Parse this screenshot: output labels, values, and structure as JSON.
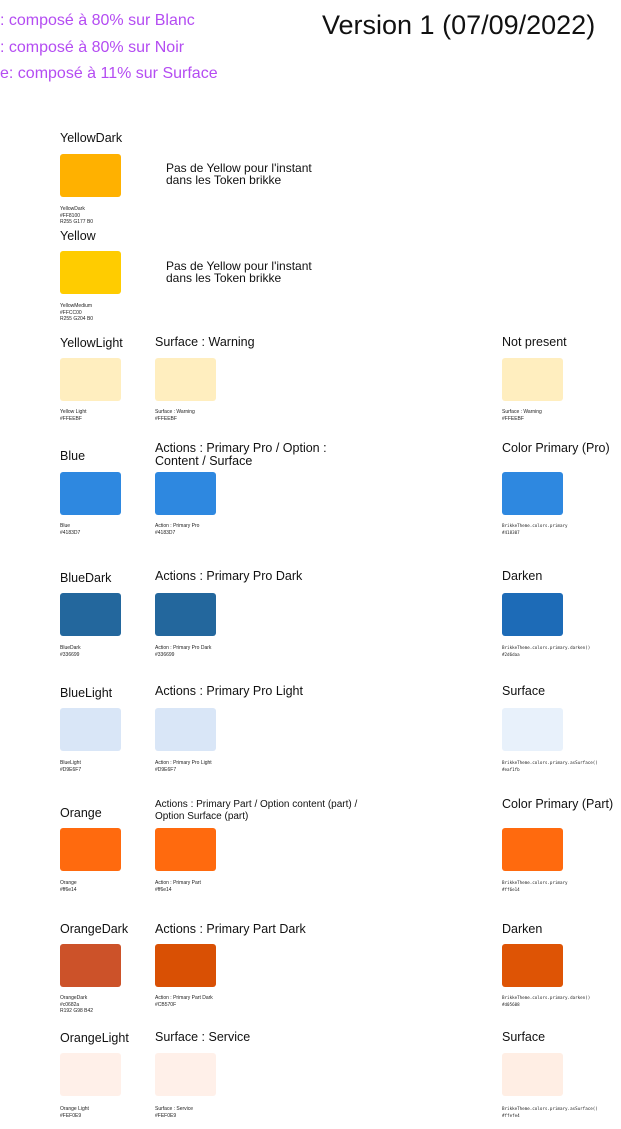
{
  "legend": [
    ": composé à 80% sur Blanc",
    ": composé à 80% sur Noir",
    "e: composé à 11% sur Surface"
  ],
  "version": "Version 1 (07/09/2022)",
  "yellow_dark": {
    "title": "YellowDark",
    "color": "#FFB100",
    "caption": [
      "YellowDark",
      "#FF8100",
      "R255 G177 B0"
    ],
    "note": [
      "Pas de Yellow pour l'instant",
      "dans les Token brikke"
    ]
  },
  "yellow": {
    "title": "Yellow",
    "color": "#FFCC00",
    "caption": [
      "YellowMedium",
      "#FFCC00",
      "R255 G204 B0"
    ],
    "note": [
      "Pas de Yellow pour l'instant",
      "dans les Token brikke"
    ]
  },
  "yellow_light": {
    "title": "YellowLight",
    "c1": {
      "color": "#FFEEBF",
      "caption": [
        "Yellow Light",
        "#FFEEBF"
      ]
    },
    "c2": {
      "title": "Surface : Warning",
      "color": "#FFEEBF",
      "caption": [
        "Surface : Warning",
        "#FFEEBF"
      ]
    },
    "c3": {
      "title": "Not present",
      "color": "#FFEEBF",
      "caption": [
        "Surface : Warning",
        "#FFEEBF"
      ]
    }
  },
  "blue": {
    "title": "Blue",
    "c1": {
      "color": "#2E88E0",
      "caption": [
        "Blue",
        "#4183D7"
      ]
    },
    "c2": {
      "title": [
        "Actions : Primary Pro / Option :",
        "Content / Surface"
      ],
      "color": "#2E88E0",
      "caption": [
        "Action : Primary Pro",
        "#4183D7"
      ]
    },
    "c3": {
      "title": "Color Primary (Pro)",
      "color": "#2E88E0",
      "caption": [
        "BrikkeTheme.colors.primary",
        "#418307"
      ]
    }
  },
  "blue_dark": {
    "title": "BlueDark",
    "c1": {
      "color": "#23679D",
      "caption": [
        "BlueDark",
        "#336699"
      ]
    },
    "c2": {
      "title": "Actions : Primary Pro Dark",
      "color": "#23679D",
      "caption": [
        "Action : Primary Pro Dark",
        "#336699"
      ]
    },
    "c3": {
      "title": "Darken",
      "color": "#1D6BB7",
      "caption": [
        "BrikkeTheme.colors.primary.darken()",
        "#2d6daa"
      ]
    }
  },
  "blue_light": {
    "title": "BlueLight",
    "c1": {
      "color": "#D9E6F7",
      "caption": [
        "BlueLight",
        "#D9E6F7"
      ]
    },
    "c2": {
      "title": "Actions : Primary Pro Light",
      "color": "#D9E6F7",
      "caption": [
        "Action : Primary Pro Light",
        "#D9E6F7"
      ]
    },
    "c3": {
      "title": "Surface",
      "color": "#E8F1FB",
      "caption": [
        "BrikkeTheme.colors.primary.asSurface()",
        "#eaf1fb"
      ]
    }
  },
  "orange": {
    "title": "Orange",
    "c1": {
      "color": "#FF6A0E",
      "caption": [
        "Orange",
        "#ff6e14"
      ]
    },
    "c2": {
      "title": [
        "Actions : Primary Part / Option content (part) /",
        "Option Surface (part)"
      ],
      "color": "#FF6A0E",
      "caption": [
        "Action : Primary Part",
        "#ff6e14"
      ]
    },
    "c3": {
      "title": "Color Primary (Part)",
      "color": "#FF6A0E",
      "caption": [
        "BrikkeTheme.colors.primary",
        "#ff6e14"
      ]
    }
  },
  "orange_dark": {
    "title": "OrangeDark",
    "c1": {
      "color": "#CC5229",
      "caption": [
        "OrangeDark",
        "#c0682a",
        "R192 G98 B42"
      ]
    },
    "c2": {
      "title": "Actions : Primary Part Dark",
      "color": "#D95004",
      "caption": [
        "Action : Primary Part Dark",
        "#CB570F"
      ]
    },
    "c3": {
      "title": "Darken",
      "color": "#DE5405",
      "caption": [
        "BrikkeTheme.colors.primary.darken()",
        "#d05608"
      ]
    }
  },
  "orange_light": {
    "title": "OrangeLight",
    "c1": {
      "color": "#FFF0E9",
      "caption": [
        "Orange Light",
        "#FEF0E9"
      ]
    },
    "c2": {
      "title": "Surface : Service",
      "color": "#FFF0E9",
      "caption": [
        "Surface : Service",
        "#FEF0E9"
      ]
    },
    "c3": {
      "title": "Surface",
      "color": "#FFEEE4",
      "caption": [
        "BrikkeTheme.colors.primary.asSurface()",
        "#ffefe4"
      ]
    }
  }
}
